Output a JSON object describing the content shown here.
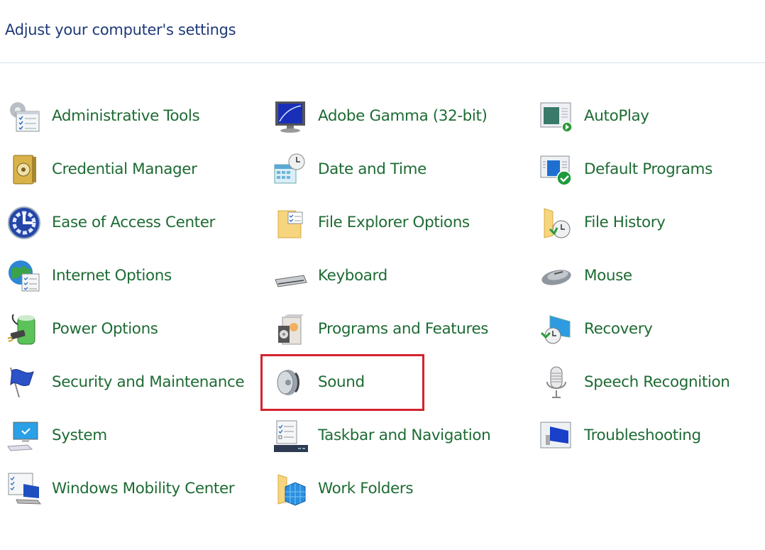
{
  "header": {
    "title": "Adjust your computer's settings"
  },
  "highlight": {
    "target": "Sound",
    "color": "#d2232e"
  },
  "colors": {
    "title": "#1e3a78",
    "item_text": "#1e6b34",
    "divider": "#d8e2ea"
  },
  "items": [
    {
      "label": "Administrative Tools",
      "icon": "admin-tools-icon"
    },
    {
      "label": "Adobe Gamma (32-bit)",
      "icon": "monitor-gamma-icon"
    },
    {
      "label": "AutoPlay",
      "icon": "autoplay-icon"
    },
    {
      "label": "Credential Manager",
      "icon": "safe-vault-icon"
    },
    {
      "label": "Date and Time",
      "icon": "calendar-clock-icon"
    },
    {
      "label": "Default Programs",
      "icon": "default-programs-icon"
    },
    {
      "label": "Ease of Access Center",
      "icon": "ease-of-access-icon"
    },
    {
      "label": "File Explorer Options",
      "icon": "folder-options-icon"
    },
    {
      "label": "File History",
      "icon": "folder-clock-icon"
    },
    {
      "label": "Internet Options",
      "icon": "globe-checklist-icon"
    },
    {
      "label": "Keyboard",
      "icon": "keyboard-icon"
    },
    {
      "label": "Mouse",
      "icon": "mouse-icon"
    },
    {
      "label": "Power Options",
      "icon": "battery-plug-icon"
    },
    {
      "label": "Programs and Features",
      "icon": "programs-box-icon"
    },
    {
      "label": "Recovery",
      "icon": "recovery-icon"
    },
    {
      "label": "Security and Maintenance",
      "icon": "flag-icon"
    },
    {
      "label": "Sound",
      "icon": "speaker-icon"
    },
    {
      "label": "Speech Recognition",
      "icon": "microphone-icon"
    },
    {
      "label": "System",
      "icon": "computer-icon"
    },
    {
      "label": "Taskbar and Navigation",
      "icon": "taskbar-icon"
    },
    {
      "label": "Troubleshooting",
      "icon": "troubleshooting-icon"
    },
    {
      "label": "Windows Mobility Center",
      "icon": "laptop-checklist-icon"
    },
    {
      "label": "Work Folders",
      "icon": "work-folders-icon"
    }
  ]
}
